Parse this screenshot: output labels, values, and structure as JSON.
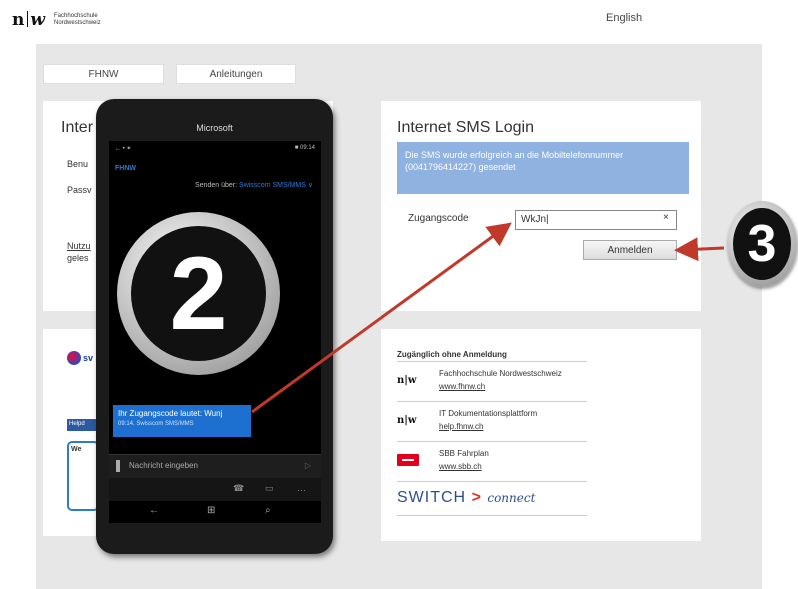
{
  "header": {
    "logo_mark_n": "n",
    "logo_mark_w": "w",
    "logo_line1": "Fachhochschule",
    "logo_line2": "Nordwestschweiz",
    "language": "English"
  },
  "tabs": [
    {
      "label": "FHNW"
    },
    {
      "label": "Anleitungen"
    }
  ],
  "left_panel": {
    "title_fragment": "Inter",
    "label1": "Benu",
    "label2": "Passv",
    "label3": "Nutzu",
    "label4": "geles",
    "provider_fragment": "sv",
    "strip_fragment": "Helpd",
    "card_fragment": "We"
  },
  "sms_login": {
    "title": "Internet SMS Login",
    "message": "Die SMS wurde erfolgreich an die Mobiltelefonnummer (0041796414227) gesendet",
    "code_label": "Zugangscode",
    "code_value": "WkJn|",
    "clear_symbol": "×",
    "login_button": "Anmelden"
  },
  "access": {
    "title": "Zugänglich ohne Anmeldung",
    "items": [
      {
        "icon": "n|w",
        "title": "Fachhochschule Nordwestschweiz",
        "link": "www.fhnw.ch"
      },
      {
        "icon": "n|w",
        "title": "IT Dokumentationsplattform",
        "link": "help.fhnw.ch"
      },
      {
        "icon": "sbb-logo",
        "title": "SBB Fahrplan",
        "link": "www.sbb.ch"
      }
    ],
    "switch_word": "SWITCH",
    "switch_arrow": ">",
    "switch_connect": "connect"
  },
  "phone": {
    "brand": "Microsoft",
    "status_left": "← • ✶",
    "status_time": "■ 09:14",
    "app_name": "FHNW",
    "send_via_label": "Senden über:",
    "send_via_value": "Swisscom SMS/MMS ∨",
    "message_text": "Ihr Zugangscode lautet: Wunj",
    "message_meta": "09:14, Swisscom SMS/MMS",
    "input_placeholder": "Nachricht eingeben",
    "send_symbol": "▷",
    "action_phone": "☎",
    "action_screen": "▭",
    "action_more": "…",
    "nav_back": "←",
    "nav_home": "⊞",
    "nav_search": "⌕"
  },
  "badges": {
    "step2": "2",
    "step3": "3"
  },
  "colors": {
    "accent_blue": "#8fb2e0",
    "phone_blue": "#1e70d0",
    "arrow_red": "#c0392b"
  }
}
